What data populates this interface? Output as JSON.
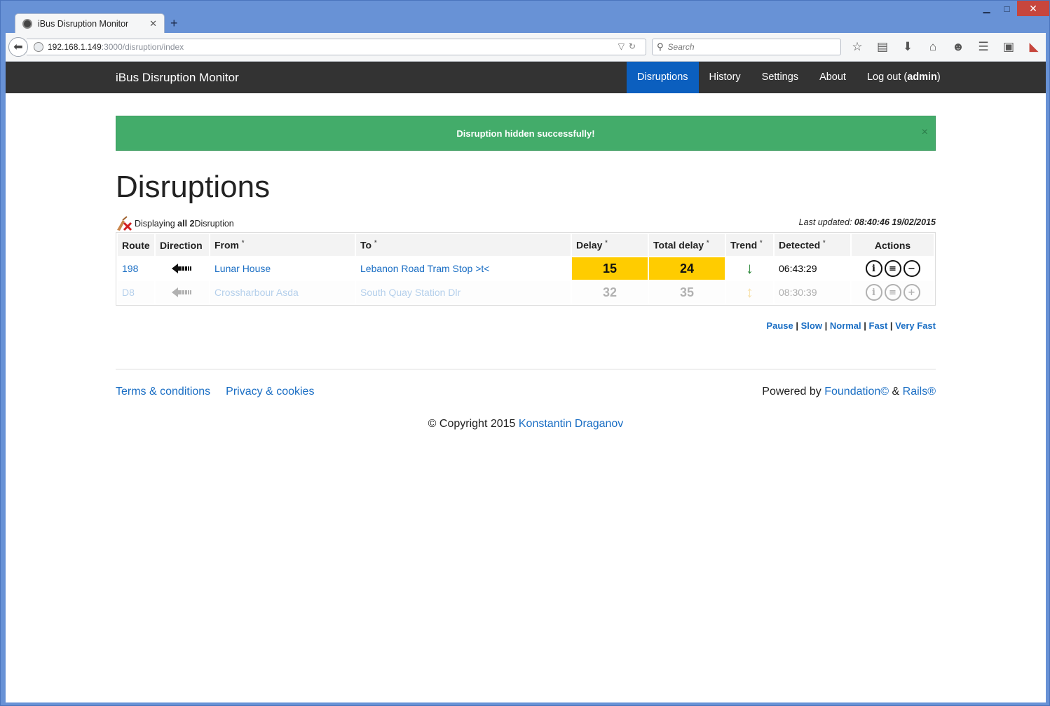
{
  "browser": {
    "tab_title": "iBus Disruption Monitor",
    "url_host": "192.168.1.149",
    "url_path": ":3000/disruption/index",
    "search_placeholder": "Search"
  },
  "navbar": {
    "brand": "iBus Disruption Monitor",
    "items": [
      {
        "label": "Disruptions",
        "active": true
      },
      {
        "label": "History"
      },
      {
        "label": "Settings"
      },
      {
        "label": "About"
      }
    ],
    "logout_prefix": "Log out (",
    "logout_user": "admin",
    "logout_suffix": ")"
  },
  "alert": {
    "message": "Disruption hidden successfully!",
    "close": "×"
  },
  "page": {
    "title": "Disruptions",
    "display_prefix": "Displaying ",
    "display_bold": "all 2",
    "display_suffix": " Disruption",
    "last_updated_label": "Last updated:",
    "last_updated_value": "08:40:46 19/02/2015"
  },
  "table": {
    "headers": {
      "route": "Route",
      "direction": "Direction",
      "from": "From",
      "to": "To",
      "delay": "Delay",
      "total_delay": "Total delay",
      "trend": "Trend",
      "detected": "Detected",
      "actions": "Actions",
      "sort_mark": "*"
    },
    "rows": [
      {
        "route": "198",
        "from": "Lunar House",
        "to": "Lebanon Road Tram Stop >t<",
        "delay": "15",
        "total_delay": "24",
        "trend": "↓",
        "detected": "06:43:29",
        "hidden": false,
        "action3": "−"
      },
      {
        "route": "D8",
        "from": "Crossharbour Asda",
        "to": "South Quay Station Dlr",
        "delay": "32",
        "total_delay": "35",
        "trend": "↕",
        "detected": "08:30:39",
        "hidden": true,
        "action3": "+"
      }
    ]
  },
  "speed": {
    "pause": "Pause",
    "slow": "Slow",
    "normal": "Normal",
    "fast": "Fast",
    "very_fast": "Very Fast",
    "sep": "|"
  },
  "footer": {
    "terms": "Terms & conditions",
    "privacy": "Privacy & cookies",
    "powered_prefix": "Powered by ",
    "foundation": "Foundation©",
    "amp": " & ",
    "rails": "Rails®",
    "copyright_prefix": "© Copyright 2015 ",
    "author": "Konstantin Draganov"
  },
  "colors": {
    "navbar_bg": "#333333",
    "nav_active": "#0b5fbf",
    "alert_bg": "#43ac6a",
    "delay_bg": "#ffcc00",
    "link": "#1a6ec4"
  }
}
